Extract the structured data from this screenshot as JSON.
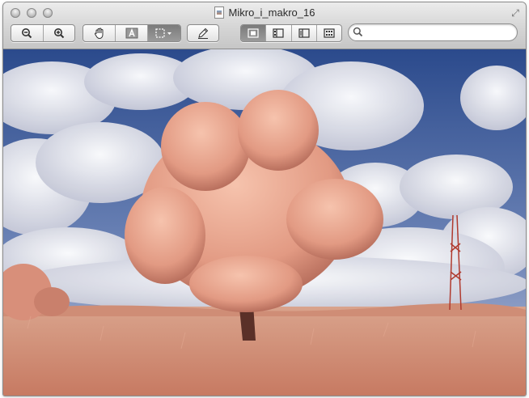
{
  "window": {
    "title": "Mikro_i_makro_16",
    "title_icon": "document-image-icon"
  },
  "toolbar": {
    "zoom_group": [
      {
        "name": "zoom-out-button",
        "icon": "zoom-out-icon"
      },
      {
        "name": "zoom-in-button",
        "icon": "zoom-in-icon"
      }
    ],
    "tools_group": [
      {
        "name": "hand-tool-button",
        "icon": "hand-icon"
      },
      {
        "name": "text-select-button",
        "icon": "text-select-icon"
      },
      {
        "name": "rect-select-button",
        "icon": "rectangle-selection-icon",
        "active": true
      }
    ],
    "annotate": {
      "name": "annotate-button",
      "icon": "pencil-icon"
    },
    "view_group": [
      {
        "name": "view-content-only-button",
        "icon": "content-only-icon",
        "active": true
      },
      {
        "name": "view-thumbnails-button",
        "icon": "thumbnails-icon"
      },
      {
        "name": "view-table-of-contents-button",
        "icon": "toc-icon"
      },
      {
        "name": "view-contact-sheet-button",
        "icon": "contact-sheet-icon"
      }
    ]
  },
  "search": {
    "value": "",
    "placeholder": "",
    "icon": "search-icon"
  },
  "image": {
    "description_colors": {
      "sky": "#2d4a86",
      "cloud": "#e6e6ee",
      "tree": "#e8a893",
      "field": "#d48a6f"
    }
  }
}
